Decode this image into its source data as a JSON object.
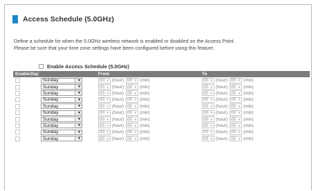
{
  "page": {
    "title": "Access Schedule (5.0GHz)",
    "description_line1": "Define a schedule for when the 5.0GHz wireless network is enabled or disabled on the Access Point.",
    "description_line2": "Please be sure that your time zone settings have been configured before using this feature.",
    "enable_all_label": "Enable Access Schedule (5.0GHz)",
    "accent_color": "#1f86c8"
  },
  "table": {
    "headers": {
      "enable": "Enable",
      "day": "Day",
      "from": "From",
      "to": "To"
    },
    "hour_unit": "(hour)",
    "min_unit": "(min)",
    "rows": [
      {
        "day": "Sunday",
        "from_hour": "00",
        "from_min": "00",
        "to_hour": "00",
        "to_min": "00"
      },
      {
        "day": "Sunday",
        "from_hour": "00",
        "from_min": "00",
        "to_hour": "00",
        "to_min": "00"
      },
      {
        "day": "Sunday",
        "from_hour": "00",
        "from_min": "00",
        "to_hour": "00",
        "to_min": "00"
      },
      {
        "day": "Sunday",
        "from_hour": "00",
        "from_min": "00",
        "to_hour": "00",
        "to_min": "00"
      },
      {
        "day": "Sunday",
        "from_hour": "00",
        "from_min": "00",
        "to_hour": "00",
        "to_min": "00"
      },
      {
        "day": "Sunday",
        "from_hour": "00",
        "from_min": "00",
        "to_hour": "00",
        "to_min": "00"
      },
      {
        "day": "Sunday",
        "from_hour": "00",
        "from_min": "00",
        "to_hour": "00",
        "to_min": "00"
      },
      {
        "day": "Sunday",
        "from_hour": "00",
        "from_min": "00",
        "to_hour": "00",
        "to_min": "00"
      },
      {
        "day": "Sunday",
        "from_hour": "00",
        "from_min": "00",
        "to_hour": "00",
        "to_min": "00"
      },
      {
        "day": "Sunday",
        "from_hour": "00",
        "from_min": "00",
        "to_hour": "00",
        "to_min": "00"
      }
    ]
  }
}
